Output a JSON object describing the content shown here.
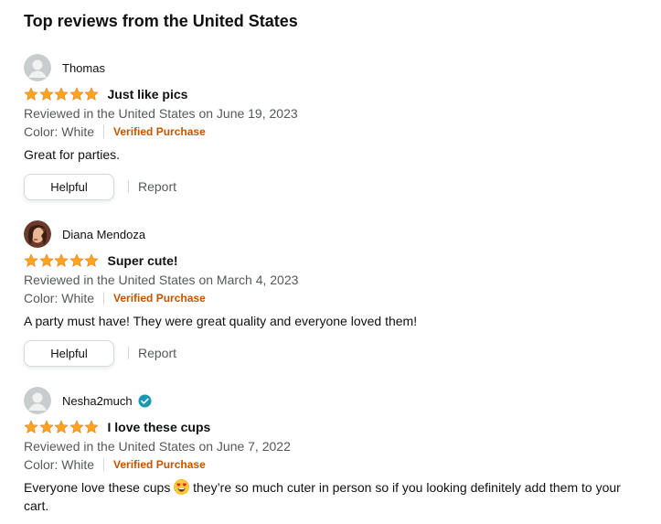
{
  "section_title": "Top reviews from the United States",
  "reviews": [
    {
      "author": "Thomas",
      "avatar": "default-avatar",
      "verified_profile": false,
      "rating": 5,
      "title": "Just like pics",
      "date": "Reviewed in the United States on June 19, 2023",
      "color": "Color: White",
      "verified": "Verified Purchase",
      "body": "Great for parties.",
      "helpful": "Helpful",
      "report": "Report"
    },
    {
      "author": "Diana Mendoza",
      "avatar": "photo-avatar",
      "verified_profile": false,
      "rating": 5,
      "title": "Super cute!",
      "date": "Reviewed in the United States on March 4, 2023",
      "color": "Color: White",
      "verified": "Verified Purchase",
      "body": "A party must have! They were great quality and everyone loved them!",
      "helpful": "Helpful",
      "report": "Report"
    },
    {
      "author": "Nesha2much",
      "avatar": "default-avatar",
      "verified_profile": true,
      "rating": 5,
      "title": "I love these cups",
      "date": "Reviewed in the United States on June 7, 2022",
      "color": "Color: White",
      "verified": "Verified Purchase",
      "body_before_emoji": "Everyone love these cups",
      "emoji": "heart-eyes-emoji",
      "body_after_emoji": " they’re so much cuter in person so if you looking definitely add them to your cart."
    }
  ],
  "colors": {
    "star": "#ffa41c",
    "verified": "#c45500",
    "secondary_text": "#565959",
    "check_badge": "#1a98b0"
  }
}
